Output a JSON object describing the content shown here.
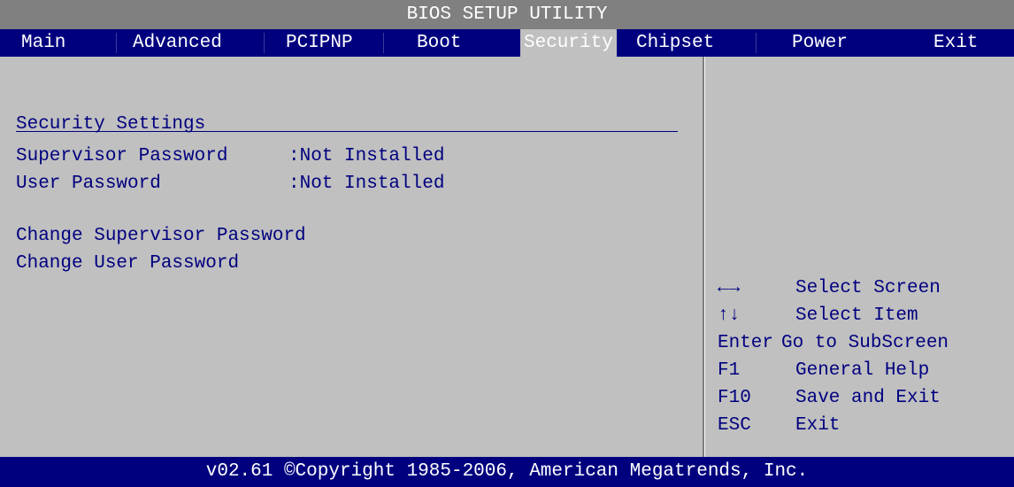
{
  "app": {
    "title": "BIOS SETUP UTILITY"
  },
  "menu": {
    "tabs": [
      {
        "label": "Main"
      },
      {
        "label": "Advanced"
      },
      {
        "label": "PCIPNP"
      },
      {
        "label": "Boot"
      },
      {
        "label": "Security"
      },
      {
        "label": "Chipset"
      },
      {
        "label": "Power"
      },
      {
        "label": "Exit"
      }
    ],
    "active": "Security"
  },
  "main": {
    "section_title": "Security Settings",
    "status": [
      {
        "label": "Supervisor Password",
        "value": ":Not Installed"
      },
      {
        "label": "User Password",
        "value": ":Not Installed"
      }
    ],
    "items": [
      {
        "label": "Change Supervisor Password"
      },
      {
        "label": "Change User Password"
      }
    ]
  },
  "help": {
    "keys": [
      {
        "key": "←→",
        "key_icon": "left-right-arrow-icon",
        "desc": "Select Screen"
      },
      {
        "key": "↑↓",
        "key_icon": "up-down-arrow-icon",
        "desc": "Select Item"
      },
      {
        "key": "Enter",
        "desc": "Go to SubScreen"
      },
      {
        "key": "F1",
        "desc": "General Help"
      },
      {
        "key": "F10",
        "desc": "Save and Exit"
      },
      {
        "key": "ESC",
        "desc": "Exit"
      }
    ]
  },
  "footer": {
    "text": "v02.61 ©Copyright 1985-2006, American Megatrends, Inc."
  },
  "colors": {
    "title_bg": "#808080",
    "menu_bg": "#00007f",
    "body_bg": "#c0c0c0",
    "text": "#00007f",
    "highlight_text": "#ffffff"
  }
}
